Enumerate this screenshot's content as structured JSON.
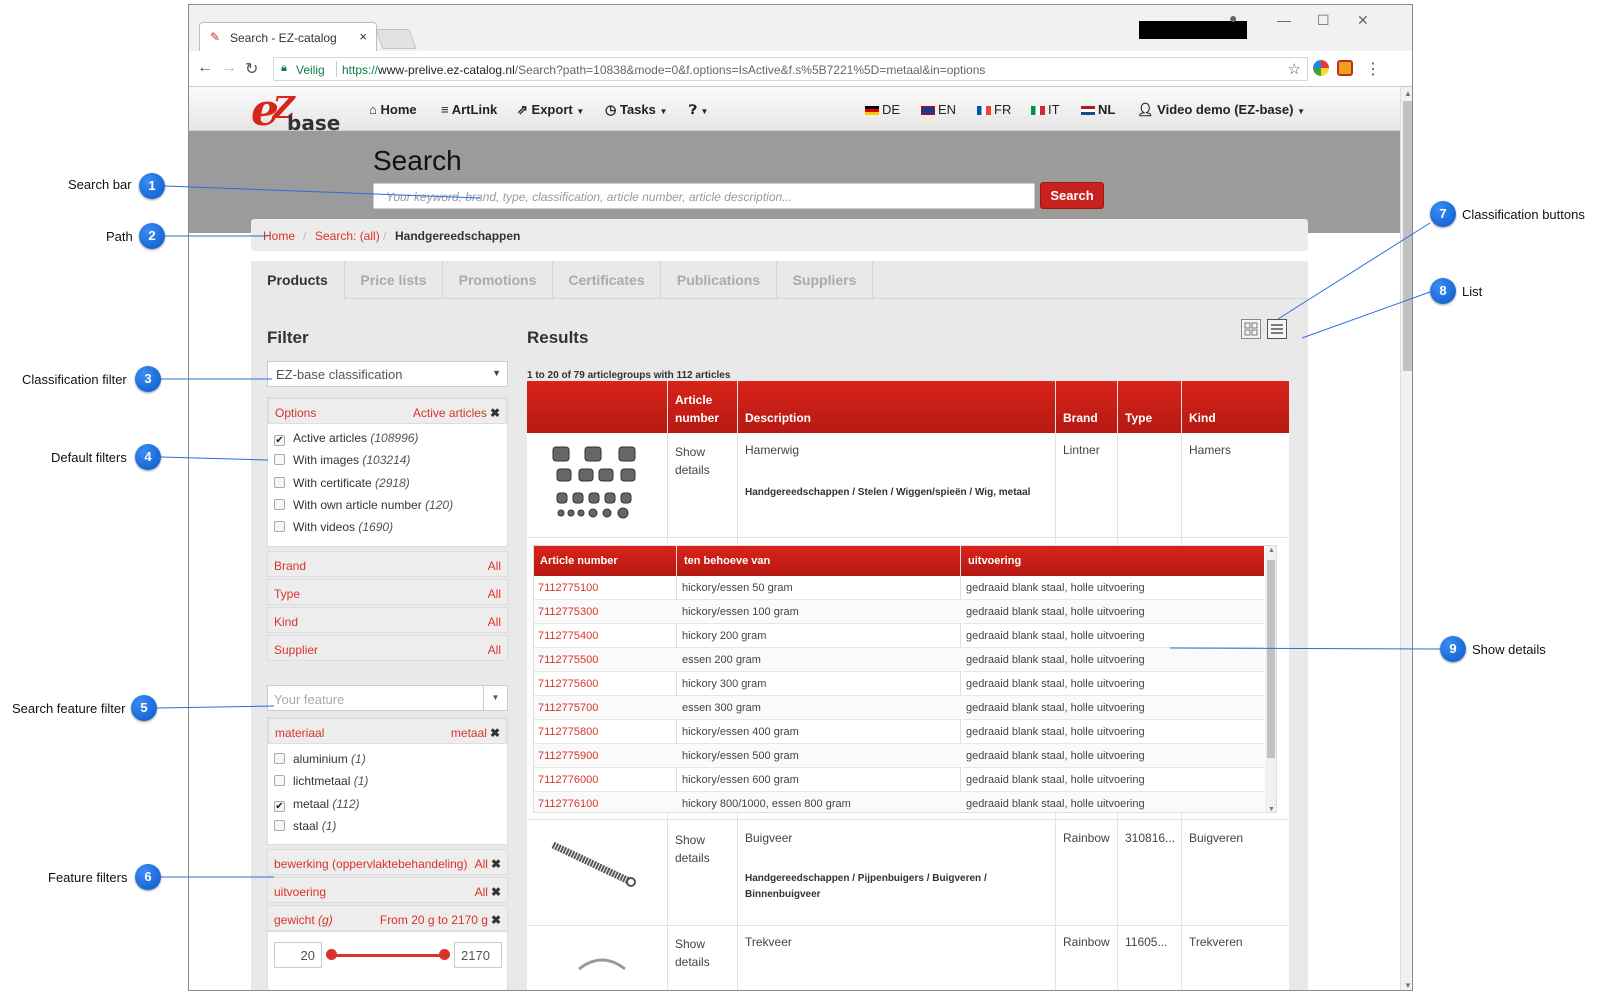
{
  "browser": {
    "tab_title": "Search - EZ-catalog",
    "tab_close": "×",
    "secure_label": "Veilig",
    "url_scheme": "https://",
    "url_host": "www-prelive.ez-catalog.nl",
    "url_rest": "/Search?path=10838&mode=0&f.options=IsActive&f.s%5B7221%5D=metaal&in=options"
  },
  "topnav": {
    "logo_text": "base",
    "items": [
      "Home",
      "ArtLink",
      "Export",
      "Tasks"
    ],
    "languages": [
      "DE",
      "EN",
      "FR",
      "IT",
      "NL"
    ],
    "user": "Video demo (EZ-base)"
  },
  "hero": {
    "title": "Search",
    "search_placeholder": "Your keyword, brand, type, classification, article number, article description...",
    "search_button": "Search"
  },
  "breadcrumb": {
    "home": "Home",
    "search": "Search: (all)",
    "current": "Handgereedschappen"
  },
  "tabs": [
    "Products",
    "Price lists",
    "Promotions",
    "Certificates",
    "Publications",
    "Suppliers"
  ],
  "filter": {
    "title": "Filter",
    "classification_select": "EZ-base classification",
    "options_label": "Options",
    "options_value": "Active articles",
    "options": [
      {
        "label": "Active articles",
        "count": "(108996)",
        "checked": true
      },
      {
        "label": "With images",
        "count": "(103214)",
        "checked": false
      },
      {
        "label": "With certificate",
        "count": "(2918)",
        "checked": false
      },
      {
        "label": "With own article number",
        "count": "(120)",
        "checked": false
      },
      {
        "label": "With videos",
        "count": "(1690)",
        "checked": false
      }
    ],
    "simple_filters": [
      {
        "label": "Brand",
        "value": "All"
      },
      {
        "label": "Type",
        "value": "All"
      },
      {
        "label": "Kind",
        "value": "All"
      },
      {
        "label": "Supplier",
        "value": "All"
      }
    ],
    "feature_placeholder": "Your feature",
    "materiaal_label": "materiaal",
    "materiaal_value": "metaal",
    "materiaal_options": [
      {
        "label": "aluminium",
        "count": "(1)",
        "checked": false
      },
      {
        "label": "lichtmetaal",
        "count": "(1)",
        "checked": false
      },
      {
        "label": "metaal",
        "count": "(112)",
        "checked": true
      },
      {
        "label": "staal",
        "count": "(1)",
        "checked": false
      }
    ],
    "bewerking_label": "bewerking (oppervlaktebehandeling)",
    "bewerking_value": "All",
    "uitvoering_label": "uitvoering",
    "uitvoering_value": "All",
    "gewicht_label": "gewicht",
    "gewicht_unit": "(g)",
    "gewicht_value": "From 20 g to 2170 g",
    "range_min": "20",
    "range_max": "2170"
  },
  "results": {
    "title": "Results",
    "info": "1 to 20 of 79 articlegroups with 112 articles",
    "columns": [
      "Article number",
      "Description",
      "Brand",
      "Type",
      "Kind"
    ],
    "show_details": [
      "Show",
      "details"
    ],
    "rows": [
      {
        "description": "Hamerwig",
        "path": "Handgereedschappen / Stelen / Wiggen/spieën / Wig, metaal",
        "brand": "Lintner",
        "type": "",
        "kind": "Hamers"
      },
      {
        "description": "Buigveer",
        "path": "Handgereedschappen / Pijpenbuigers / Buigveren / Binnenbuigveer",
        "brand": "Rainbow",
        "type": "310816...",
        "kind": "Buigveren"
      },
      {
        "description": "Trekveer",
        "path": "",
        "brand": "Rainbow",
        "type": "11605...",
        "kind": "Trekveren"
      }
    ],
    "detail_columns": [
      "Article number",
      "ten behoeve van",
      "uitvoering"
    ],
    "detail_rows": [
      [
        "7112775100",
        "hickory/essen 50 gram",
        "gedraaid blank staal, holle uitvoering"
      ],
      [
        "7112775300",
        "hickory/essen 100 gram",
        "gedraaid blank staal, holle uitvoering"
      ],
      [
        "7112775400",
        "hickory 200 gram",
        "gedraaid blank staal, holle uitvoering"
      ],
      [
        "7112775500",
        "essen 200 gram",
        "gedraaid blank staal, holle uitvoering"
      ],
      [
        "7112775600",
        "hickory 300 gram",
        "gedraaid blank staal, holle uitvoering"
      ],
      [
        "7112775700",
        "essen 300 gram",
        "gedraaid blank staal, holle uitvoering"
      ],
      [
        "7112775800",
        "hickory/essen 400 gram",
        "gedraaid blank staal, holle uitvoering"
      ],
      [
        "7112775900",
        "hickory/essen 500 gram",
        "gedraaid blank staal, holle uitvoering"
      ],
      [
        "7112776000",
        "hickory/essen 600 gram",
        "gedraaid blank staal, holle uitvoering"
      ],
      [
        "7112776100",
        "hickory 800/1000, essen 800 gram",
        "gedraaid blank staal, holle uitvoering"
      ]
    ]
  },
  "callouts": [
    {
      "num": "1",
      "label": "Search bar"
    },
    {
      "num": "2",
      "label": "Path"
    },
    {
      "num": "3",
      "label": "Classification filter"
    },
    {
      "num": "4",
      "label": "Default filters"
    },
    {
      "num": "5",
      "label": "Search feature filter"
    },
    {
      "num": "6",
      "label": "Feature filters"
    },
    {
      "num": "7",
      "label": "Classification buttons"
    },
    {
      "num": "8",
      "label": "List"
    },
    {
      "num": "9",
      "label": "Show details"
    }
  ],
  "colors": {
    "accent": "#d9241a",
    "link": "#d9342b",
    "callout": "#0a59c9"
  }
}
